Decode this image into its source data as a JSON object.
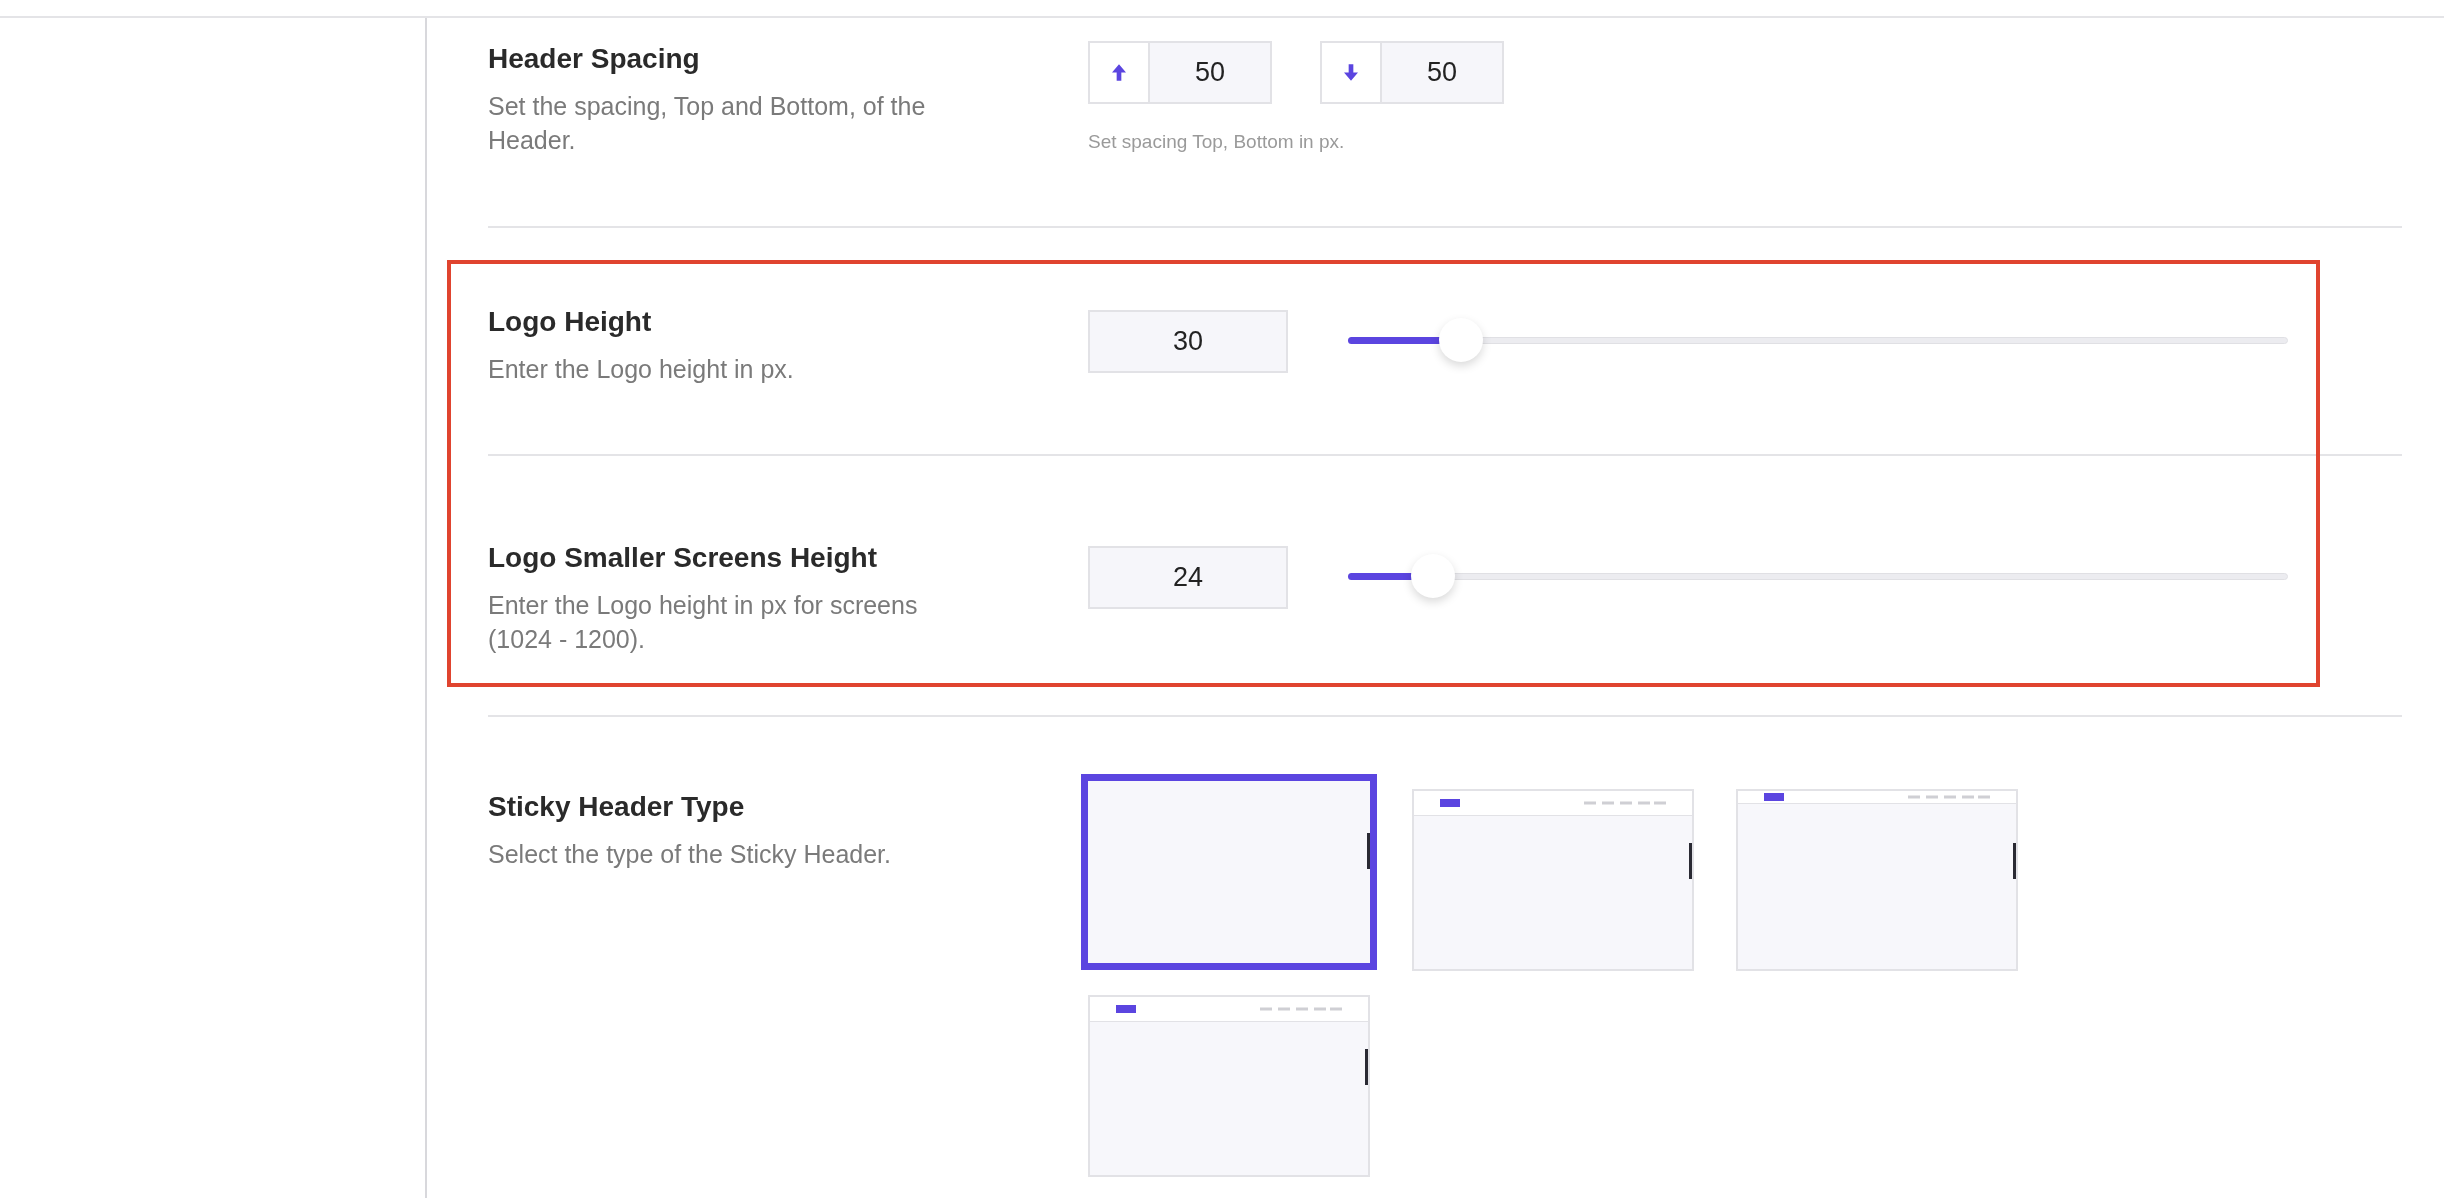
{
  "sections": [
    {
      "kind": "spacing",
      "title": "Header Spacing",
      "description": "Set the spacing, Top and Bottom, of the Header.",
      "fields": [
        {
          "kind": "up",
          "value": "50"
        },
        {
          "kind": "down",
          "value": "50"
        }
      ],
      "help": "Set spacing Top, Bottom in px."
    },
    {
      "kind": "group",
      "highlighted": true,
      "children": [
        {
          "kind": "slider",
          "title": "Logo Height",
          "description": "Enter the Logo height in px.",
          "value": "30",
          "level": 0.12
        },
        {
          "kind": "slider",
          "title": "Logo Smaller Screens Height",
          "description": "Enter the Logo height in px for screens (1024 - 1200).",
          "value": "24",
          "level": 0.09
        }
      ]
    },
    {
      "kind": "layout_picker",
      "title": "Sticky Header Type",
      "description": "Select the type of the Sticky Header.",
      "options": [
        {
          "kind": "none",
          "selected": true
        },
        {
          "kind": "tall",
          "selected": false
        },
        {
          "kind": "slim",
          "selected": false
        },
        {
          "kind": "tall",
          "selected": false
        }
      ]
    }
  ]
}
